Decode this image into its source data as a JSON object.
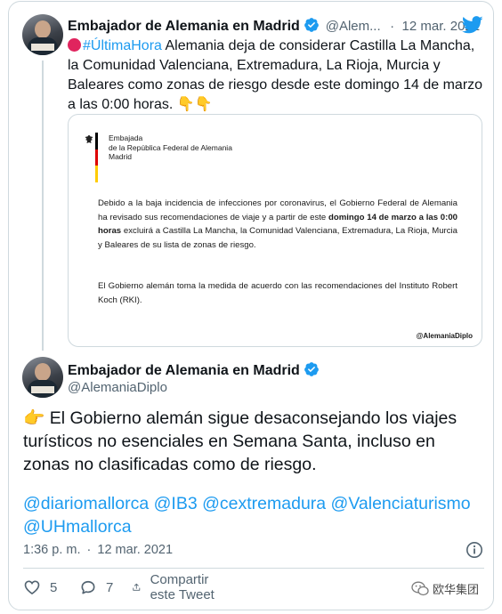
{
  "parent_tweet": {
    "author_name": "Embajador de Alemania en Madrid",
    "handle": "@Alem...",
    "date_sep": "·",
    "date": "12 mar. 2021",
    "hashtag": "#ÚltimaHora",
    "text": " Alemania deja de considerar Castilla La Mancha, la Comunidad Valenciana, Extremadura, La Rioja, Murcia y Baleares como zonas de riesgo desde este domingo 14 de marzo a las 0:00 horas.",
    "emoji_trailing": "👇👇"
  },
  "document": {
    "org_line1": "Embajada",
    "org_line2": "de la República Federal de Alemania",
    "org_line3": "Madrid",
    "p1_a": "Debido a la baja incidencia de infecciones por coronavirus, el Gobierno Federal de Alemania ha revisado sus recomendaciones de viaje y a partir de este ",
    "p1_bold": "domingo 14 de marzo a las 0:00 horas",
    "p1_b": " excluirá a Castilla La Mancha, la Comunidad Valenciana, Extremadura, La Rioja, Murcia y Baleares de su lista de zonas de riesgo.",
    "p2": "El Gobierno alemán toma la medida de acuerdo con las recomendaciones del Instituto Robert Koch (RKI).",
    "signature": "@AlemaniaDiplo",
    "flag_colors": [
      "#000000",
      "#dd0000",
      "#ffcc00"
    ]
  },
  "main_tweet": {
    "author_name": "Embajador de Alemania en Madrid",
    "handle": "@AlemaniaDiplo",
    "emoji_lead": "👉",
    "text": " El Gobierno alemán sigue desaconsejando los viajes turísticos no esenciales en Semana Santa, incluso en zonas no clasificadas como de riesgo.",
    "mentions": [
      "@diariomallorca",
      "@IB3",
      "@cextremadura",
      "@Valenciaturismo",
      "@UHmallorca"
    ],
    "time": "1:36 p. m.",
    "meta_sep": "·",
    "date": "12 mar. 2021"
  },
  "actions": {
    "likes": "5",
    "replies": "7",
    "share_label": "Compartir este Tweet"
  },
  "watermark": "欧华集团",
  "colors": {
    "accent": "#1d9bf0",
    "text": "#0f1419",
    "muted": "#536471",
    "border": "#cfd9de",
    "red_dot": "#e0245e"
  }
}
